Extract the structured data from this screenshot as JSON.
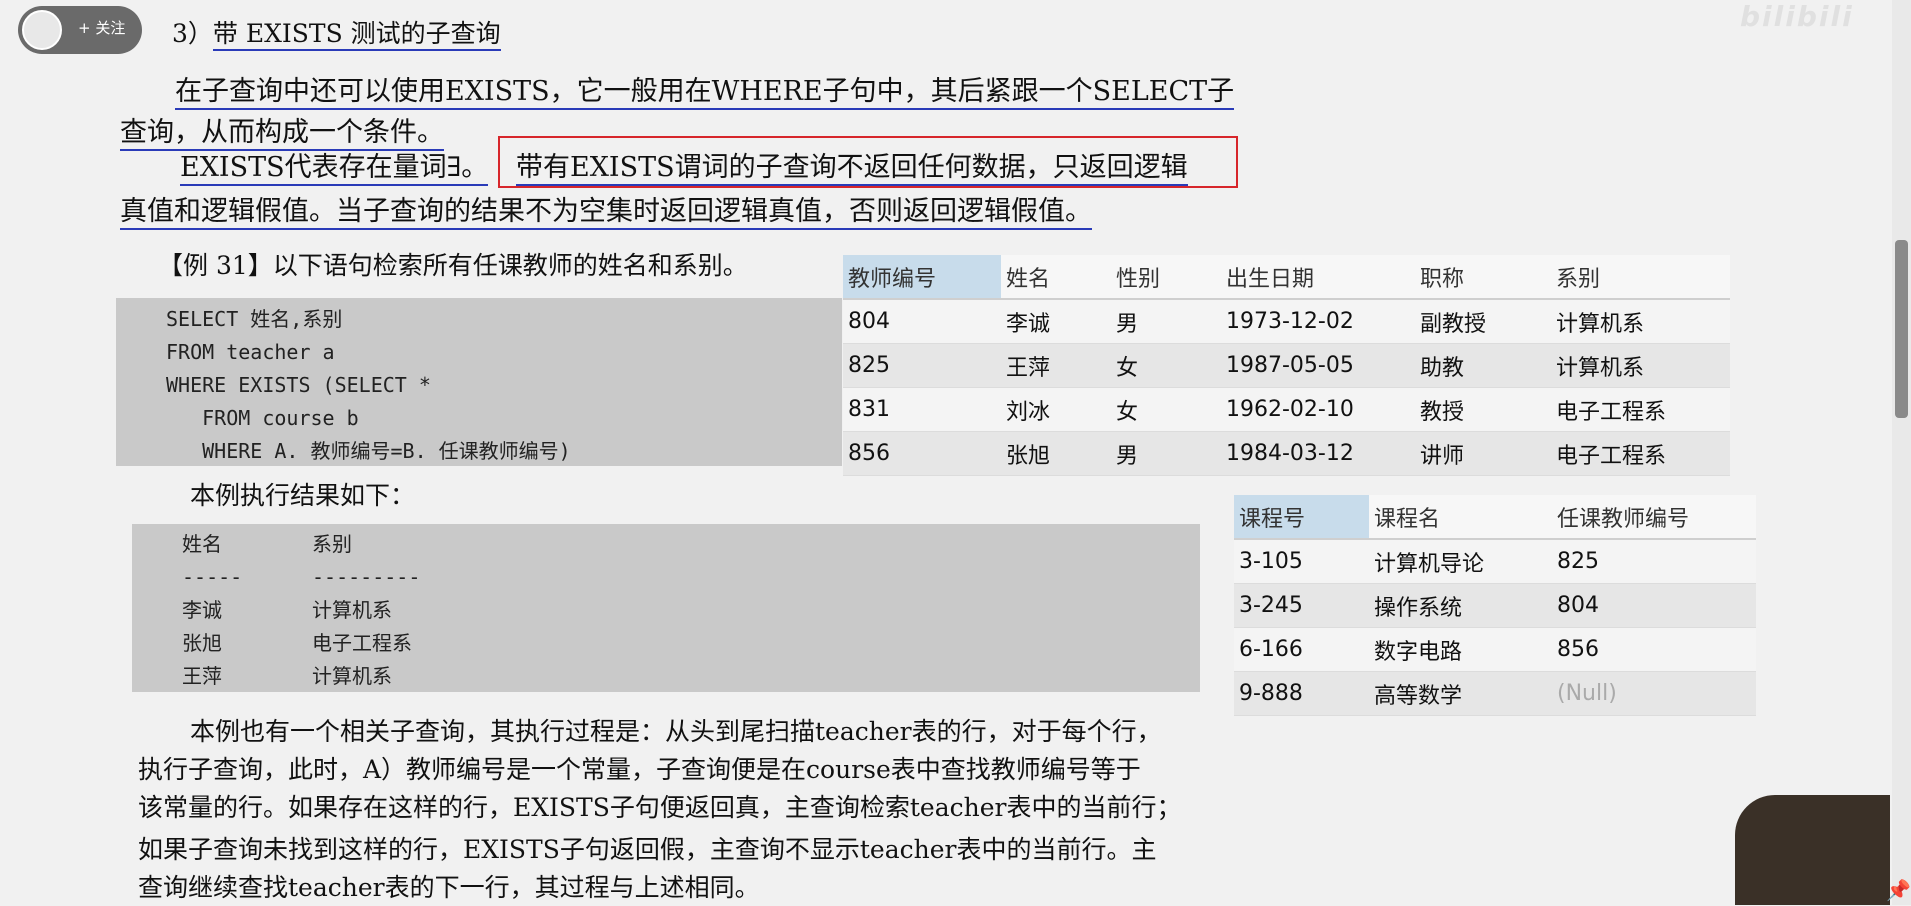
{
  "follow": {
    "icon": "avatar-icon",
    "label": "+ 关注"
  },
  "watermark": "bilibili",
  "heading": {
    "num": "3）",
    "text": "带 EXISTS 测试的子查询"
  },
  "para1": {
    "line1": "在子查询中还可以使用EXISTS，它一般用在WHERE子句中，其后紧跟一个SELECT子",
    "line2": "查询，从而构成一个条件。"
  },
  "para2": {
    "line1_prefix": "EXISTS代表存在量词∃。",
    "line1_boxed": "带有EXISTS谓词的子查询不返回任何数据，只返回逻辑",
    "line2": "真值和逻辑假值。当子查询的结果不为空集时返回逻辑真值，否则返回逻辑假值。"
  },
  "example": {
    "title": "【例 31】以下语句检索所有任课教师的姓名和系别。"
  },
  "sql": [
    "SELECT 姓名,系别",
    "FROM teacher a",
    "WHERE EXISTS (SELECT *",
    "   FROM course b",
    "   WHERE A. 教师编号=B. 任课教师编号)"
  ],
  "result_intro": "本例执行结果如下：",
  "result": {
    "headers": [
      "姓名",
      "系别"
    ],
    "dashes": [
      "-----",
      "---------"
    ],
    "rows": [
      [
        "李诚",
        "计算机系"
      ],
      [
        "张旭",
        "电子工程系"
      ],
      [
        "王萍",
        "计算机系"
      ]
    ]
  },
  "teacher_table": {
    "headers": [
      "教师编号",
      "姓名",
      "性别",
      "出生日期",
      "职称",
      "系别"
    ],
    "rows": [
      [
        "804",
        "李诚",
        "男",
        "1973-12-02",
        "副教授",
        "计算机系"
      ],
      [
        "825",
        "王萍",
        "女",
        "1987-05-05",
        "助教",
        "计算机系"
      ],
      [
        "831",
        "刘冰",
        "女",
        "1962-02-10",
        "教授",
        "电子工程系"
      ],
      [
        "856",
        "张旭",
        "男",
        "1984-03-12",
        "讲师",
        "电子工程系"
      ]
    ]
  },
  "course_table": {
    "headers": [
      "课程号",
      "课程名",
      "任课教师编号"
    ],
    "rows": [
      [
        "3-105",
        "计算机导论",
        "825"
      ],
      [
        "3-245",
        "操作系统",
        "804"
      ],
      [
        "6-166",
        "数字电路",
        "856"
      ],
      [
        "9-888",
        "高等数学",
        "(Null)"
      ]
    ]
  },
  "explanation": [
    "本例也有一个相关子查询，其执行过程是：从头到尾扫描teacher表的行，对于每个行，",
    "执行子查询，此时，A）教师编号是一个常量，子查询便是在course表中查找教师编号等于",
    "该常量的行。如果存在这样的行，EXISTS子句便返回真，主查询检索teacher表中的当前行；",
    "如果子查询未找到这样的行，EXISTS子句返回假，主查询不显示teacher表中的当前行。主",
    "查询继续查找teacher表的下一行，其过程与上述相同。"
  ],
  "colors": {
    "annotation": "#2a3bb8",
    "highlight_box": "#d7262b",
    "selected_header": "#c8dceb"
  }
}
